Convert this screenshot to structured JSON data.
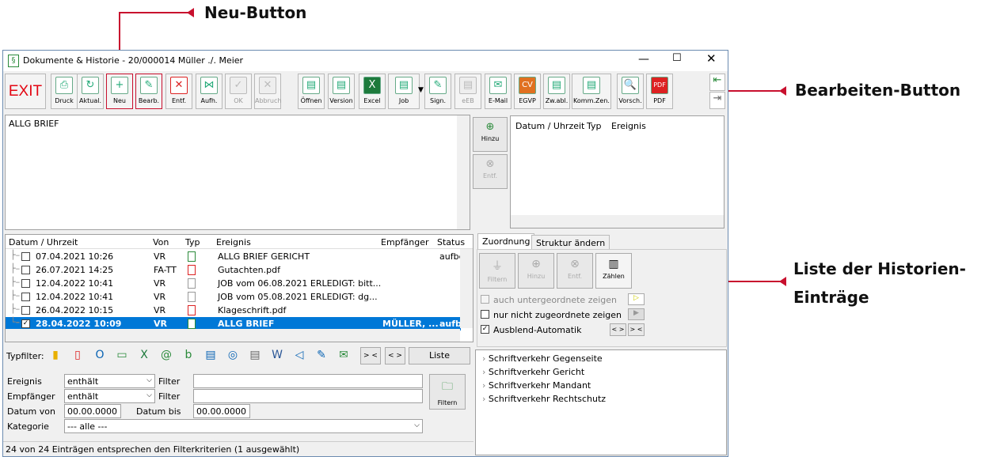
{
  "callouts": {
    "new": "Neu-Button",
    "edit": "Bearbeiten-Button",
    "list_line1": "Liste der Historien-",
    "list_line2": "Einträge"
  },
  "window": {
    "title": "Dokumente & Historie - 20/000014  Müller ./. Meier",
    "icon": "document-section-icon"
  },
  "toolbar": {
    "exit": "EXIT",
    "buttons": [
      "Druck",
      "Aktual.",
      "Neu",
      "Bearb.",
      "Entf.",
      "Aufh.",
      "OK",
      "Abbruch",
      "Öffnen",
      "Version",
      "Excel",
      "Job",
      "Sign.",
      "eEB",
      "E-Mail",
      "EGVP",
      "Zw.abl.",
      "Komm.Zen.",
      "Vorsch.",
      "PDF"
    ]
  },
  "top_left_text": "ALLG BRIEF",
  "side_buttons": {
    "add": "Hinzu",
    "remove": "Entf."
  },
  "top_right_headers": [
    "Datum / Uhrzeit",
    "Typ",
    "Ereignis"
  ],
  "list": {
    "headers": [
      "Datum / Uhrzeit",
      "Von",
      "Typ",
      "Ereignis",
      "Empfänger",
      "Status"
    ],
    "rows": [
      {
        "date": "07.04.2021  10:26",
        "from": "VR",
        "event": "ALLG BRIEF GERICHT",
        "recipient": "",
        "status": "aufbe",
        "checked": false
      },
      {
        "date": "26.07.2021  14:25",
        "from": "FA-TT",
        "event": "Gutachten.pdf",
        "recipient": "",
        "status": "",
        "checked": false
      },
      {
        "date": "12.04.2022  10:41",
        "from": "VR",
        "event": "JOB vom 06.08.2021  ERLEDIGT: bitt...",
        "recipient": "",
        "status": "",
        "checked": false
      },
      {
        "date": "12.04.2022  10:41",
        "from": "VR",
        "event": "JOB vom 05.08.2021  ERLEDIGT: dg...",
        "recipient": "",
        "status": "",
        "checked": false
      },
      {
        "date": "26.04.2022  10:15",
        "from": "VR",
        "event": "Klageschrift.pdf",
        "recipient": "",
        "status": "",
        "checked": false
      },
      {
        "date": "28.04.2022  10:09",
        "from": "VR",
        "event": "ALLG BRIEF",
        "recipient": "MÜLLER, ...",
        "status": "aufbe",
        "checked": true
      }
    ]
  },
  "typfilter": {
    "label": "Typfilter:",
    "btn1": ">  <",
    "btn2": "<  >",
    "list_button": "Liste"
  },
  "filter": {
    "ereignis_label": "Ereignis",
    "ereignis_value": "enthält",
    "filter1_label": "Filter",
    "empfaenger_label": "Empfänger",
    "empfaenger_value": "enthält",
    "filter2_label": "Filter",
    "datum_von_label": "Datum von",
    "datum_von_value": "00.00.0000",
    "datum_bis_label": "Datum bis",
    "datum_bis_value": "00.00.0000",
    "kategorie_label": "Kategorie",
    "kategorie_value": "--- alle ---",
    "filter_button": "Filtern"
  },
  "status_bar": "24 von 24 Einträgen entsprechen den Filterkriterien (1 ausgewählt)",
  "tabs": [
    "Zuordnung",
    "Struktur ändern"
  ],
  "assign_buttons": [
    "Filtern",
    "Hinzu",
    "Entf.",
    "Zählen"
  ],
  "options": {
    "opt1": "auch untergeordnete zeigen",
    "opt2": "nur nicht zugeordnete zeigen",
    "opt3": "Ausblend-Automatik",
    "small1": "< >",
    "small2": "> <"
  },
  "tree": [
    "Schriftverkehr Gegenseite",
    "Schriftverkehr Gericht",
    "Schriftverkehr Mandant",
    "Schriftverkehr Rechtschutz"
  ],
  "colors": {
    "accent": "#c8102e",
    "selection": "#0078d7",
    "exit": "#e30613"
  }
}
